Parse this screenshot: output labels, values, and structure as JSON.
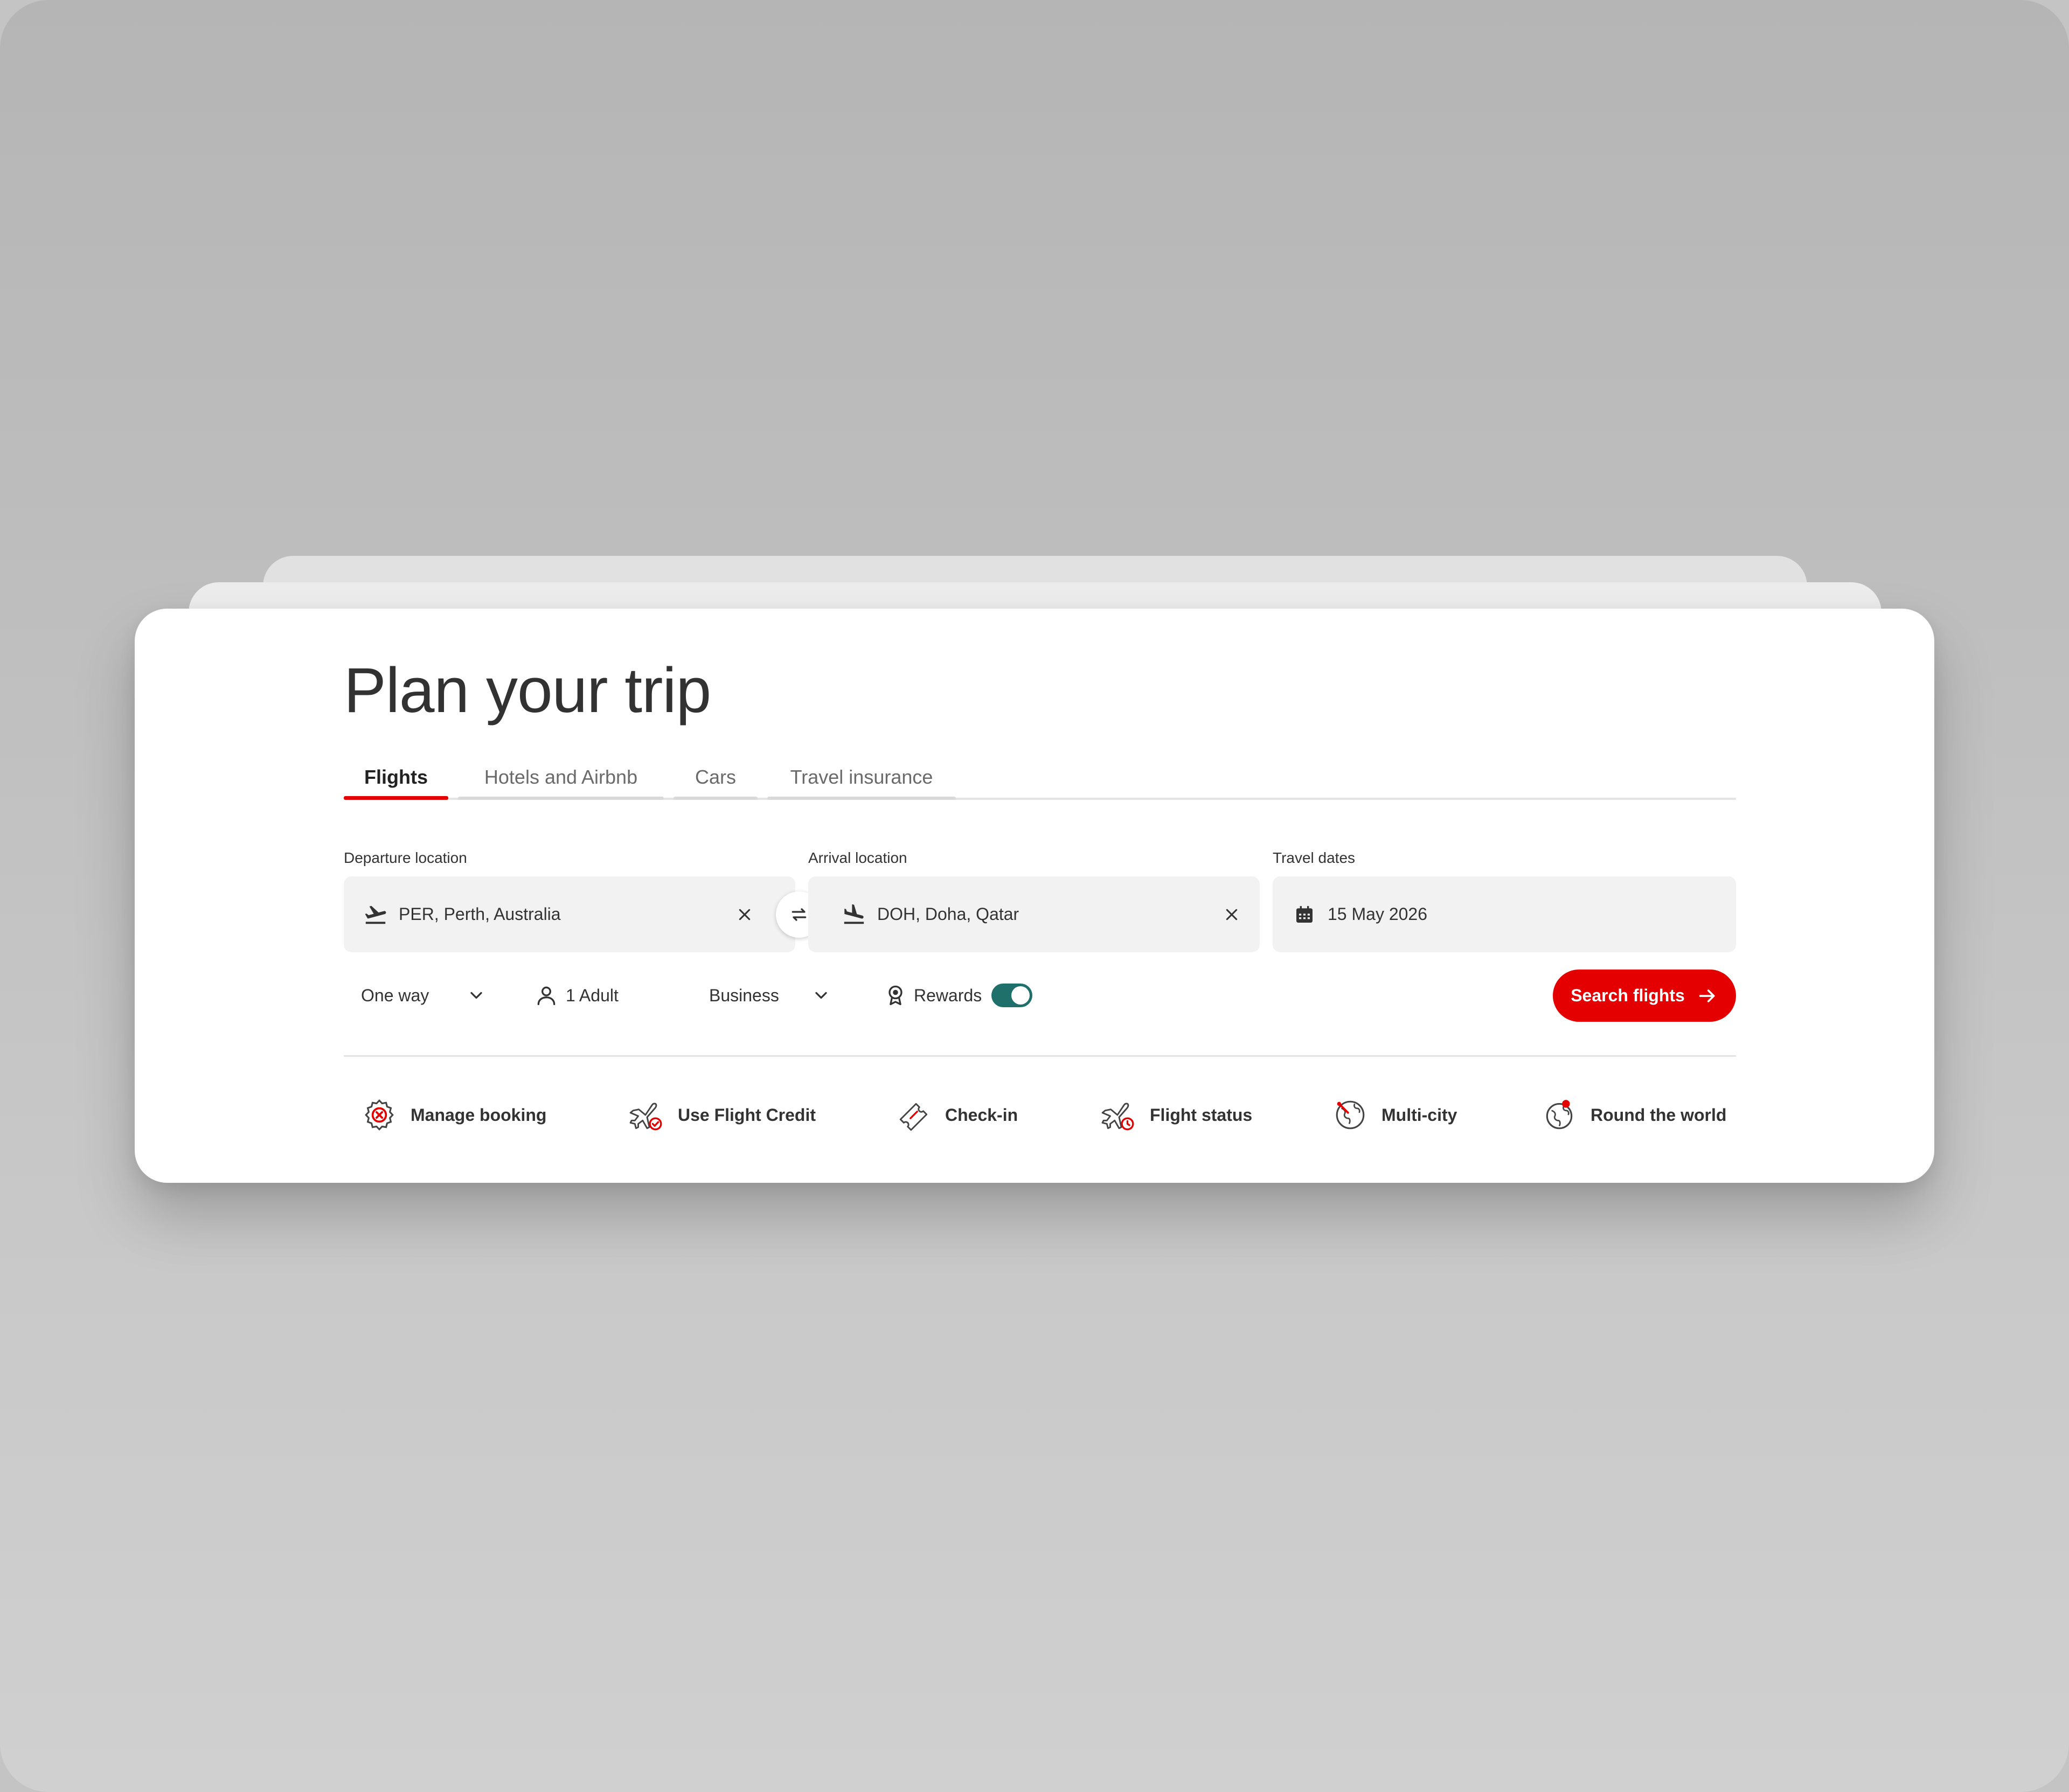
{
  "page_title": "Plan your trip",
  "tabs": [
    {
      "label": "Flights",
      "active": true
    },
    {
      "label": "Hotels and Airbnb",
      "active": false
    },
    {
      "label": "Cars",
      "active": false
    },
    {
      "label": "Travel insurance",
      "active": false
    }
  ],
  "departure": {
    "label": "Departure location",
    "value": "PER, Perth, Australia",
    "icon": "plane-takeoff-icon"
  },
  "arrival": {
    "label": "Arrival location",
    "value": "DOH, Doha, Qatar",
    "icon": "plane-landing-icon"
  },
  "dates": {
    "label": "Travel dates",
    "value": "15 May 2026",
    "icon": "calendar-icon"
  },
  "trip_type": "One way",
  "passengers": "1 Adult",
  "cabin_class": "Business",
  "rewards": {
    "label": "Rewards",
    "enabled": true
  },
  "search_button": "Search flights",
  "quick_links": [
    {
      "label": "Manage booking",
      "icon": "gear-cancel-icon"
    },
    {
      "label": "Use Flight Credit",
      "icon": "plane-check-icon"
    },
    {
      "label": "Check-in",
      "icon": "ticket-icon"
    },
    {
      "label": "Flight status",
      "icon": "plane-clock-icon"
    },
    {
      "label": "Multi-city",
      "icon": "globe-route-icon"
    },
    {
      "label": "Round the world",
      "icon": "globe-pin-icon"
    }
  ],
  "colors": {
    "accent": "#e40000",
    "toggle": "#1f6f6b",
    "field_bg": "#f2f2f2"
  }
}
